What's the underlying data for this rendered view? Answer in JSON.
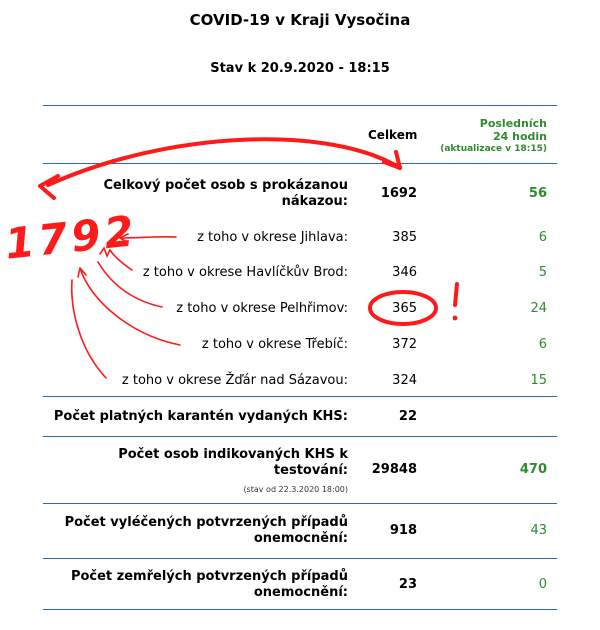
{
  "title": "COVID-19 v Kraji Vysočina",
  "subtitle": "Stav k 20.9.2020 - 18:15",
  "headers": {
    "total": "Celkem",
    "last24": "Posledních",
    "last24_b": "24 hodin",
    "last24_update": "(aktualizace v 18:15)"
  },
  "rows": [
    {
      "label1": "Celkový počet osob s prokázanou",
      "label2": "nákazou:",
      "total": "1692",
      "last24": "56"
    },
    {
      "label": "z toho v okrese Jihlava:",
      "total": "385",
      "last24": "6"
    },
    {
      "label": "z toho v okrese Havlíčkův Brod:",
      "total": "346",
      "last24": "5"
    },
    {
      "label": "z toho v okrese Pelhřimov:",
      "total": "365",
      "last24": "24"
    },
    {
      "label": "z toho v okrese Třebíč:",
      "total": "372",
      "last24": "6"
    },
    {
      "label": "z toho v okrese Žďár nad Sázavou:",
      "total": "324",
      "last24": "15"
    },
    {
      "label": "Počet platných karantén vydaných KHS:",
      "total": "22",
      "last24": ""
    },
    {
      "label1": "Počet osob indikovaných KHS k",
      "label2": "testování:",
      "note": "(stav od 22.3.2020 18:00)",
      "total": "29848",
      "last24": "470"
    },
    {
      "label1": "Počet vyléčených potvrzených případů",
      "label2": "onemocnění:",
      "total": "918",
      "last24": "43"
    },
    {
      "label1": "Počet zemřelých potvrzených případů",
      "label2": "onemocnění:",
      "total": "23",
      "last24": "0"
    }
  ],
  "annotation": {
    "handwritten_number": "1792",
    "exclamation": "!",
    "color": "#ff0000"
  }
}
